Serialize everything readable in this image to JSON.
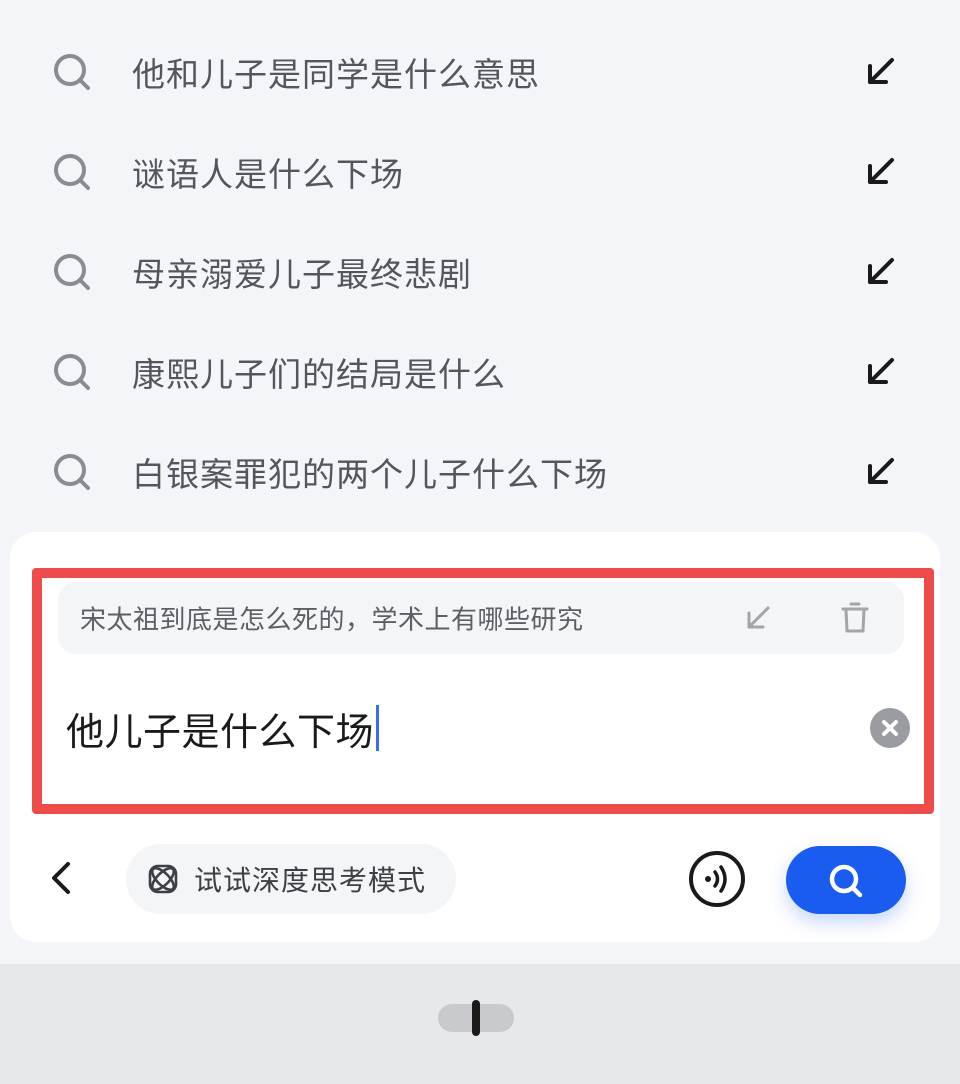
{
  "suggestions": [
    {
      "text": "他和儿子是同学是什么意思",
      "icon": "search-icon",
      "action_icon": "arrow-fill-icon"
    },
    {
      "text": "谜语人是什么下场",
      "icon": "search-icon",
      "action_icon": "arrow-fill-icon"
    },
    {
      "text": "母亲溺爱儿子最终悲剧",
      "icon": "search-icon",
      "action_icon": "arrow-fill-icon"
    },
    {
      "text": "康熙儿子们的结局是什么",
      "icon": "search-icon",
      "action_icon": "arrow-fill-icon"
    },
    {
      "text": "白银案罪犯的两个儿子什么下场",
      "icon": "search-icon",
      "action_icon": "arrow-fill-icon"
    }
  ],
  "history": {
    "text": "宋太祖到底是怎么死的，学术上有哪些研究"
  },
  "search_input": {
    "value": "他儿子是什么下场"
  },
  "toolbar": {
    "deep_think_label": "试试深度思考模式"
  },
  "colors": {
    "accent": "#1a5cf0",
    "highlight": "#ee4b4b",
    "background": "#f4f5f8",
    "panel": "#ffffff"
  }
}
